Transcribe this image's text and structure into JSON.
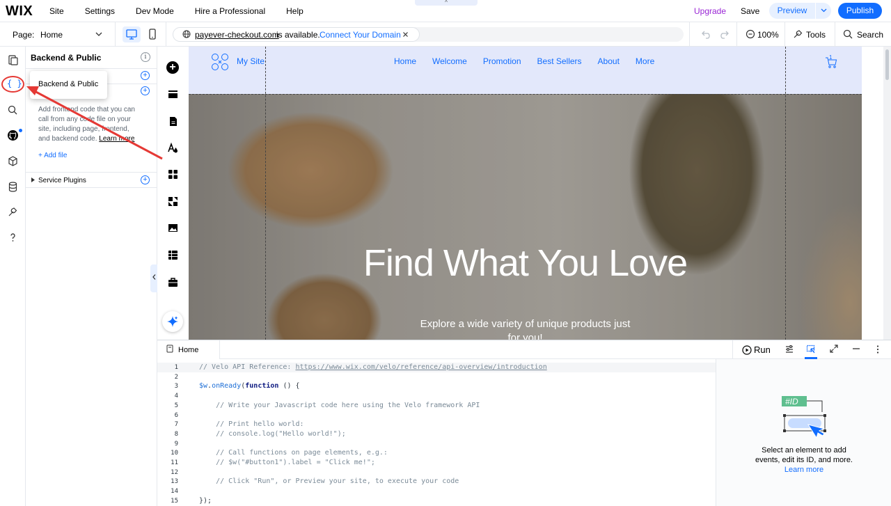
{
  "topbar": {
    "logo": "WIX",
    "menu": [
      "Site",
      "Settings",
      "Dev Mode",
      "Hire a Professional",
      "Help"
    ],
    "notch_glyph": "^",
    "upgrade": "Upgrade",
    "save": "Save",
    "preview": "Preview",
    "publish": "Publish"
  },
  "toolbar": {
    "page_label": "Page:",
    "page_value": "Home",
    "domain": "payever-checkout.com",
    "domain_status": "is available.",
    "connect_domain": "Connect Your Domain",
    "zoom": "100%",
    "tools": "Tools",
    "search": "Search"
  },
  "panel": {
    "title": "Backend & Public",
    "description_1": "Add frontend code that you can call from any code file on your site, including page, frontend, and backend code.",
    "learn_more": "Learn more",
    "add_file": "+ Add file",
    "service_plugins": "Service Plugins"
  },
  "tooltip": {
    "text": "Backend & Public"
  },
  "site": {
    "name": "My Site",
    "nav": [
      "Home",
      "Welcome",
      "Promotion",
      "Best Sellers",
      "About",
      "More"
    ],
    "cart_count": "1",
    "hero_title": "Find What You Love",
    "hero_sub_1": "Explore a wide variety of unique products just",
    "hero_sub_2": "for you!"
  },
  "code": {
    "tab": "Home",
    "run": "Run",
    "lines": [
      {
        "n": "1",
        "html": "<span class=\"cmt\">// Velo API Reference: </span><span class=\"lnk\">https://www.wix.com/velo/reference/api-overview/introduction</span>"
      },
      {
        "n": "2",
        "html": ""
      },
      {
        "n": "3",
        "html": "<span class=\"obj\">$w</span>.<span class=\"obj\">onReady</span>(<span class=\"kw\">function</span> () {"
      },
      {
        "n": "4",
        "html": ""
      },
      {
        "n": "5",
        "html": "    <span class=\"cmt\">// Write your Javascript code here using the Velo framework API</span>"
      },
      {
        "n": "6",
        "html": ""
      },
      {
        "n": "7",
        "html": "    <span class=\"cmt\">// Print hello world:</span>"
      },
      {
        "n": "8",
        "html": "    <span class=\"cmt\">// console.log(\"Hello world!\");</span>"
      },
      {
        "n": "9",
        "html": ""
      },
      {
        "n": "10",
        "html": "    <span class=\"cmt\">// Call functions on page elements, e.g.:</span>"
      },
      {
        "n": "11",
        "html": "    <span class=\"cmt\">// $w(\"#button1\").label = \"Click me!\";</span>"
      },
      {
        "n": "12",
        "html": ""
      },
      {
        "n": "13",
        "html": "    <span class=\"cmt\">// Click \"Run\", or Preview your site, to execute your code</span>"
      },
      {
        "n": "14",
        "html": ""
      },
      {
        "n": "15",
        "html": "});"
      }
    ]
  },
  "properties": {
    "id_tag": "#ID",
    "text_1": "Select an element to add",
    "text_2": "events, edit its ID, and more.",
    "learn_more": "Learn more"
  },
  "colors": {
    "accent": "#116dff",
    "upgrade": "#9a27d5",
    "annotation": "#e53935",
    "site_header": "#e3e8fb"
  }
}
